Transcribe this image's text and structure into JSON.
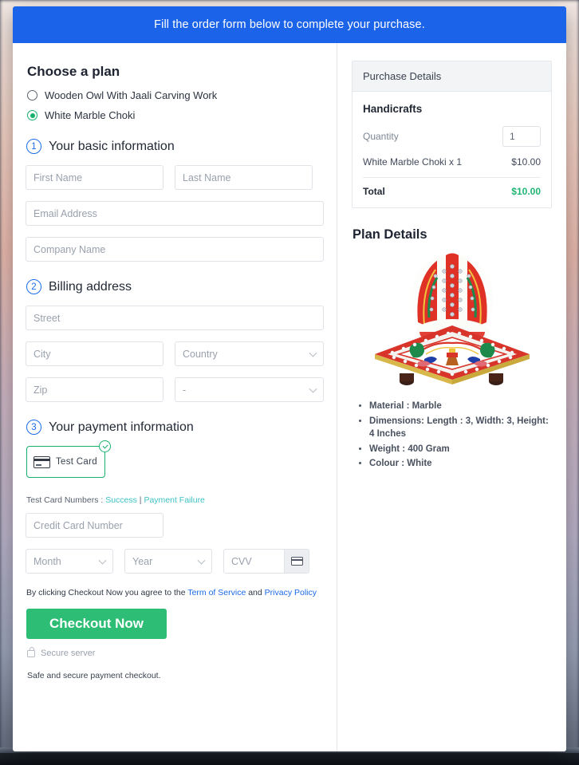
{
  "banner": {
    "text": "Fill the order form below to complete your purchase."
  },
  "plan": {
    "heading": "Choose a plan",
    "options": [
      {
        "label": "Wooden Owl With Jaali Carving Work",
        "selected": false
      },
      {
        "label": "White Marble Choki",
        "selected": true
      }
    ]
  },
  "steps": {
    "one": {
      "num": "1",
      "title": "Your basic information"
    },
    "two": {
      "num": "2",
      "title": "Billing address"
    },
    "three": {
      "num": "3",
      "title": "Your payment information"
    }
  },
  "basic": {
    "first_name": {
      "placeholder": "First Name",
      "value": ""
    },
    "last_name": {
      "placeholder": "Last Name",
      "value": ""
    },
    "email": {
      "placeholder": "Email Address",
      "value": ""
    },
    "company": {
      "placeholder": "Company Name",
      "value": ""
    }
  },
  "billing": {
    "street": {
      "placeholder": "Street",
      "value": ""
    },
    "city": {
      "placeholder": "City",
      "value": ""
    },
    "country": {
      "placeholder": "Country",
      "value": ""
    },
    "zip": {
      "placeholder": "Zip",
      "value": ""
    },
    "state": {
      "placeholder": "-",
      "value": "-"
    }
  },
  "payment": {
    "card_option_label": "Test Card",
    "test_numbers_prefix": "Test Card Numbers : ",
    "link_success": "Success",
    "separator": " | ",
    "link_failure": "Payment Failure",
    "credit_card": {
      "placeholder": "Credit Card Number",
      "value": ""
    },
    "month": {
      "placeholder": "Month",
      "value": ""
    },
    "year": {
      "placeholder": "Year",
      "value": ""
    },
    "cvv": {
      "placeholder": "CVV",
      "value": ""
    }
  },
  "footer": {
    "terms_prefix": "By clicking Checkout Now you agree to the ",
    "terms_link": "Term of Service",
    "terms_mid": " and ",
    "privacy_link": "Privacy Policy",
    "checkout_label": "Checkout Now",
    "secure_server": "Secure server",
    "safe_note": "Safe and secure payment checkout."
  },
  "purchase": {
    "header": "Purchase Details",
    "category": "Handicrafts",
    "quantity_label": "Quantity",
    "quantity_value": "1",
    "item_label": "White Marble Choki x 1",
    "item_price": "$10.00",
    "total_label": "Total",
    "total_value": "$10.00"
  },
  "plan_details": {
    "heading": "Plan Details",
    "bullets": [
      "Material : Marble",
      "Dimensions: Length : 3, Width: 3, Height: 4 Inches",
      "Weight : 400 Gram",
      "Colour : White"
    ]
  },
  "colors": {
    "banner_blue": "#1b63e8",
    "accent_green": "#17b06b",
    "button_green": "#2ebd74",
    "link_blue": "#1b6ae8",
    "link_teal": "#3fc2c4",
    "total_green": "#21b573"
  }
}
